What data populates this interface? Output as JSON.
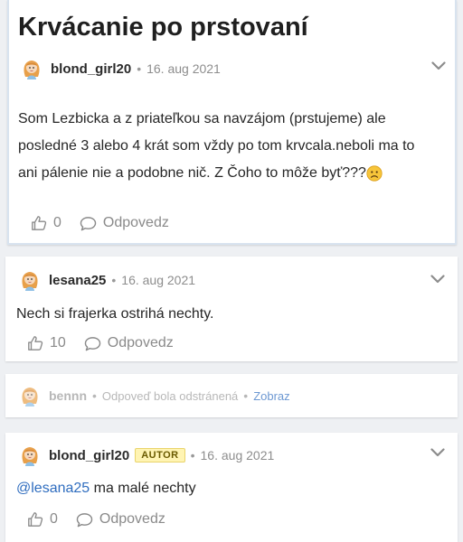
{
  "post": {
    "title": "Krvácanie po prstovaní",
    "author": "blond_girl20",
    "date": "16. aug 2021",
    "body_lines": [
      "Som Lezbicka a z priateľkou sa navzájom (prstujeme) ale",
      "posledné 3 alebo 4 krát som vždy po tom krvcala.neboli ma to",
      "ani pálenie nie a podobne nič. Z Čoho to môže byť???"
    ],
    "likes": "0",
    "reply_label": "Odpovedz",
    "icons": {
      "avatar": "blonde-girl-avatar",
      "emoji": "worried-face-emoji",
      "like": "thumbs-up-icon",
      "reply": "speech-bubble-icon",
      "menu": "chevron-down-icon"
    }
  },
  "comments": [
    {
      "author": "lesana25",
      "date": "16. aug 2021",
      "text": "Nech si frajerka ostrihá nechty.",
      "likes": "10",
      "reply_label": "Odpovedz"
    },
    {
      "author": "bennn",
      "removed_text": "Odpoveď bola odstránená",
      "show_label": "Zobraz"
    },
    {
      "author": "blond_girl20",
      "badge": "AUTOR",
      "date": "16. aug 2021",
      "mention": "@lesana25",
      "text": " ma malé nechty",
      "likes": "0",
      "reply_label": "Odpovedz"
    }
  ],
  "separator": "•"
}
